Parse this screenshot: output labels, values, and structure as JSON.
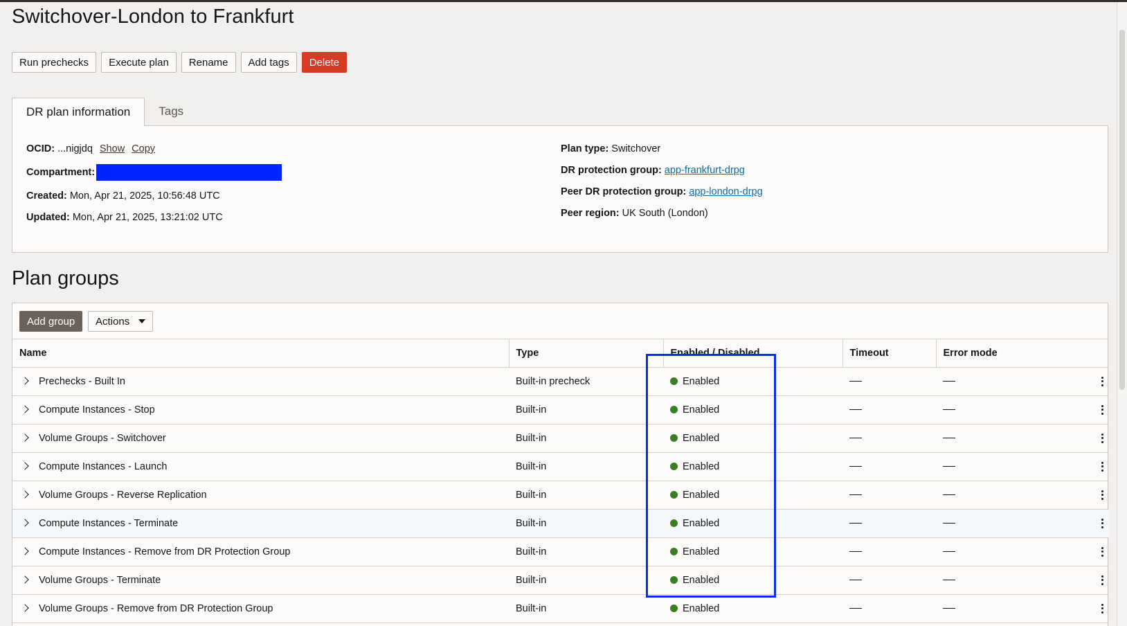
{
  "page": {
    "title": "Switchover-London to Frankfurt"
  },
  "toolbar": {
    "buttons": [
      "Run prechecks",
      "Execute plan",
      "Rename",
      "Add tags",
      "Delete"
    ]
  },
  "tabs": [
    "DR plan information",
    "Tags"
  ],
  "info": {
    "ocid_label": "OCID:",
    "ocid_value": "...nigjdq",
    "show_label": "Show",
    "copy_label": "Copy",
    "compartment_label": "Compartment:",
    "created_label": "Created:",
    "created_value": "Mon, Apr 21, 2025, 10:56:48 UTC",
    "updated_label": "Updated:",
    "updated_value": "Mon, Apr 21, 2025, 13:21:02 UTC",
    "plan_type_label": "Plan type:",
    "plan_type_value": "Switchover",
    "drpg_label": "DR protection group:",
    "drpg_value": "app-frankfurt-drpg",
    "peer_drpg_label": "Peer DR protection group:",
    "peer_drpg_value": "app-london-drpg",
    "peer_region_label": "Peer region:",
    "peer_region_value": "UK South (London)"
  },
  "plan_groups": {
    "title": "Plan groups",
    "add_group_label": "Add group",
    "actions_label": "Actions",
    "columns": [
      "Name",
      "Type",
      "Enabled / Disabled",
      "Timeout",
      "Error mode"
    ],
    "rows": [
      {
        "name": "Prechecks - Built In",
        "type": "Built-in precheck",
        "status": "Enabled"
      },
      {
        "name": "Compute Instances - Stop",
        "type": "Built-in",
        "status": "Enabled"
      },
      {
        "name": "Volume Groups - Switchover",
        "type": "Built-in",
        "status": "Enabled"
      },
      {
        "name": "Compute Instances - Launch",
        "type": "Built-in",
        "status": "Enabled"
      },
      {
        "name": "Volume Groups - Reverse Replication",
        "type": "Built-in",
        "status": "Enabled"
      },
      {
        "name": "Compute Instances - Terminate",
        "type": "Built-in",
        "status": "Enabled"
      },
      {
        "name": "Compute Instances - Remove from DR Protection Group",
        "type": "Built-in",
        "status": "Enabled"
      },
      {
        "name": "Volume Groups - Terminate",
        "type": "Built-in",
        "status": "Enabled"
      },
      {
        "name": "Volume Groups - Remove from DR Protection Group",
        "type": "Built-in",
        "status": "Enabled"
      }
    ]
  },
  "colors": {
    "danger": "#d63b25",
    "enabled": "#3b7d23",
    "link": "#0b6da8",
    "highlight_box": "#0a2ee6",
    "redaction": "#0026ff"
  }
}
